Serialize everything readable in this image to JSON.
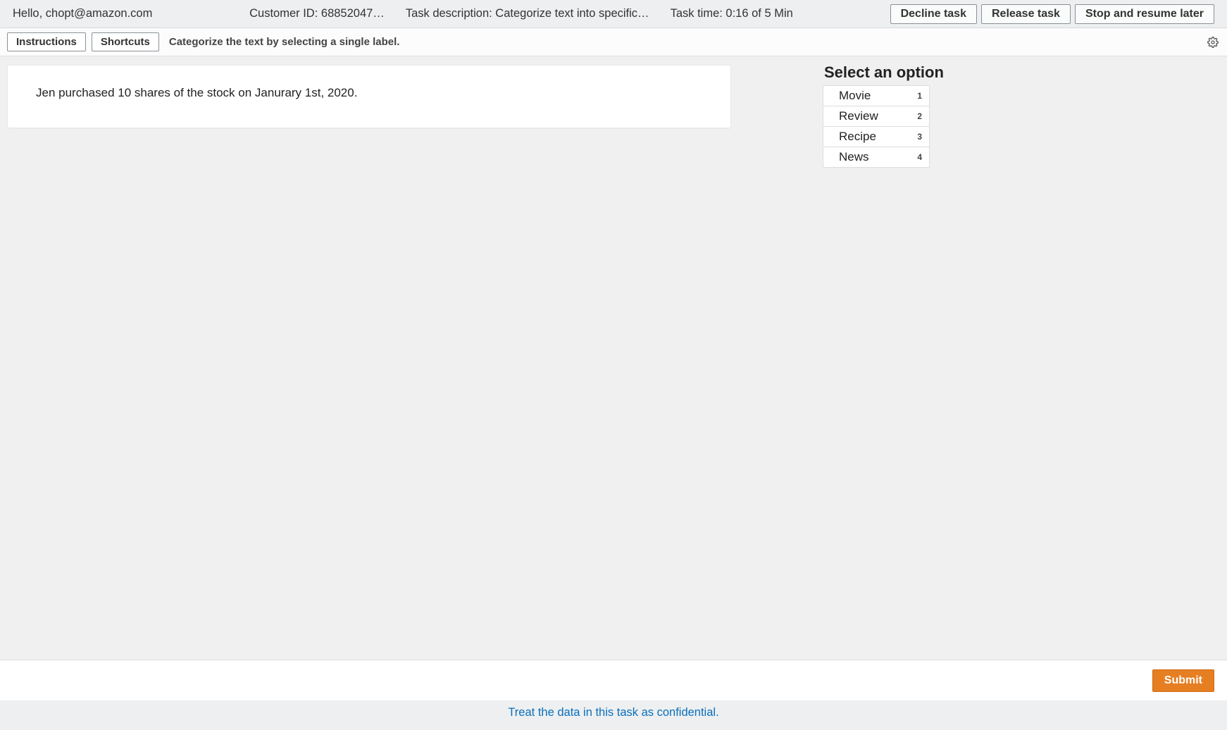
{
  "header": {
    "greeting": "Hello, chopt@amazon.com",
    "customer_id": "Customer ID: 68852047…",
    "task_description": "Task description: Categorize text into specific…",
    "task_time": "Task time: 0:16 of 5 Min",
    "decline_label": "Decline task",
    "release_label": "Release task",
    "stop_resume_label": "Stop and resume later"
  },
  "toolbar": {
    "instructions_label": "Instructions",
    "shortcuts_label": "Shortcuts",
    "prompt": "Categorize the text by selecting a single label."
  },
  "workspace": {
    "text": "Jen purchased 10 shares of the stock on Janurary 1st, 2020.",
    "options_title": "Select an option",
    "options": [
      {
        "label": "Movie",
        "key": "1"
      },
      {
        "label": "Review",
        "key": "2"
      },
      {
        "label": "Recipe",
        "key": "3"
      },
      {
        "label": "News",
        "key": "4"
      }
    ]
  },
  "footer": {
    "submit_label": "Submit",
    "confidential_notice": "Treat the data in this task as confidential."
  }
}
